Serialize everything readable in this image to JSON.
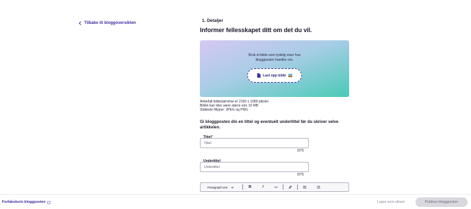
{
  "nav": {
    "back_label": "Tilbake til bloggoversikten"
  },
  "main": {
    "step_label": "1. Detaljer",
    "heading": "Informer fellesskapet ditt om det du vil."
  },
  "upload": {
    "help_line1": "Bruk et bilde som tydelig viser hva",
    "help_line2": "bloggposten handler om.",
    "button_label": "Last opp bilde"
  },
  "image_info": {
    "line1": "Anbefalt bildestørrelse er 2160 x 1080 piksler",
    "line2": "Bildet kan ikke være større enn 10 MB",
    "line3": "Støttede filtyper: JPEG og PNG"
  },
  "intro_text": "Gi bloggposten din en tittel og eventuelt undertittel før du skriver selve artikkelen.",
  "title_field": {
    "label": "Tittel",
    "required_mark": "*",
    "placeholder": "Tittel",
    "counter": "0/75"
  },
  "subtitle_field": {
    "label": "Undertittel",
    "placeholder": "Undertittel",
    "counter": "0/75"
  },
  "toolbar": {
    "format_select": "Paragraph text",
    "bold_glyph": "B",
    "italic_glyph": "I"
  },
  "footer": {
    "preview_label": "Forhåndsvis bloggposten",
    "save_draft_label": "Lagre som utkast",
    "publish_label": "Publiser bloggposten"
  },
  "colors": {
    "accent": "#3d2fa3",
    "gradient_start": "#d5c8f3",
    "gradient_end": "#49cbb6",
    "disabled_bg": "#d8d8de"
  },
  "icons": [
    "chevron-left-icon",
    "file-icon",
    "image-icon",
    "chevron-down-icon",
    "bold-icon",
    "italic-icon",
    "horizontal-rule-icon",
    "link-icon",
    "bullet-list-icon",
    "numbered-list-icon",
    "external-link-icon"
  ]
}
